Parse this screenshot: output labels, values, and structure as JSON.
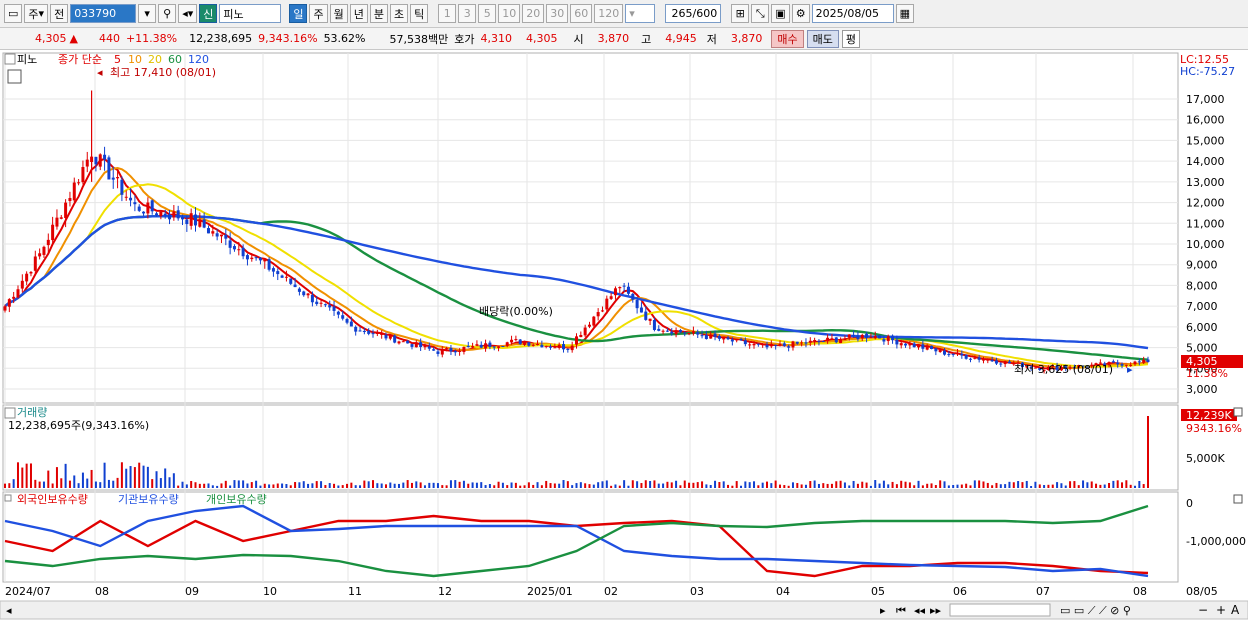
{
  "toolbar": {
    "market_btn": "주",
    "prev_btn": "전",
    "code_value": "033790",
    "badge": "신",
    "name_value": "피노",
    "periods": [
      "일",
      "주",
      "월",
      "년",
      "분",
      "초",
      "틱"
    ],
    "periods_active": "일",
    "intervals": [
      "1",
      "3",
      "5",
      "10",
      "20",
      "30",
      "60",
      "120"
    ],
    "count_value": "265",
    "count_max": "/600",
    "date_value": "2025/08/05"
  },
  "quote": {
    "price": "4,305",
    "arrow": "▲",
    "change": "440",
    "change_pct": "+11.38%",
    "volume": "12,238,695",
    "vol_pct": "9,343.16%",
    "turnover": "53.62%",
    "amount": "57,538백만",
    "hoga_label": "호가",
    "ask": "4,310",
    "bid": "4,305",
    "open_label": "시",
    "open": "3,870",
    "high_label": "고",
    "high": "4,945",
    "low_label": "저",
    "low": "3,870",
    "buy_btn": "매수",
    "sell_btn": "매도",
    "eval_btn": "평"
  },
  "price_panel": {
    "name_tag": "피노",
    "ma_title": "종가 단순",
    "ma_periods": [
      "5",
      "10",
      "20",
      "60",
      "120"
    ],
    "ma_colors": [
      "#e00000",
      "#f09000",
      "#f0e000",
      "#1a9040",
      "#2050e0"
    ],
    "max_note": "최고 17,410 (08/01)",
    "min_note": "최저 3,625 (08/01)",
    "dividend_note": "배당락(0.00%)",
    "lc": "LC:12.55",
    "hc": "HC:-75.27",
    "y_ticks": [
      "17,000",
      "16,000",
      "15,000",
      "14,000",
      "13,000",
      "12,000",
      "11,000",
      "10,000",
      "9,000",
      "8,000",
      "7,000",
      "6,000",
      "5,000",
      "4,000",
      "3,000"
    ],
    "y_values": [
      17000,
      16000,
      15000,
      14000,
      13000,
      12000,
      11000,
      10000,
      9000,
      8000,
      7000,
      6000,
      5000,
      4000,
      3000
    ],
    "last_price_tag": "4,305",
    "last_pct_tag": "11.38%"
  },
  "volume_panel": {
    "title": "거래량",
    "sub": "12,238,695주(9,343.16%)",
    "y_tick": "5,000K",
    "last_tag": "12,239K",
    "last_pct": "9343.16%"
  },
  "holding_panel": {
    "legend": [
      "외국인보유수량",
      "기관보유수량",
      "개인보유수량"
    ],
    "legend_colors": [
      "#e00000",
      "#2050e0",
      "#1a9040"
    ],
    "y_ticks": [
      "0",
      "-1,000,000"
    ]
  },
  "x_axis": {
    "labels": [
      "2024/07",
      "08",
      "09",
      "10",
      "11",
      "12",
      "2025/01",
      "02",
      "03",
      "04",
      "05",
      "06",
      "07",
      "08",
      "08/05"
    ]
  },
  "bottom": {
    "zoom_minus": "−",
    "zoom_plus": "+",
    "auto": "A"
  },
  "chart_data": {
    "type": "candlestick",
    "title": "피노",
    "unit": "KRW",
    "ylim": [
      3000,
      17500
    ],
    "months": [
      "2024/07",
      "08",
      "09",
      "10",
      "11",
      "12",
      "2025/01",
      "02",
      "03",
      "04",
      "05",
      "06",
      "07",
      "08"
    ],
    "close_approx": [
      {
        "date": "2024/07",
        "close": 7000
      },
      {
        "date": "2024/07 mid",
        "close": 9500
      },
      {
        "date": "2024/08/01",
        "close": 14500
      },
      {
        "date": "2024/08 late",
        "close": 11800
      },
      {
        "date": "2024/09",
        "close": 11200
      },
      {
        "date": "2024/10",
        "close": 9000
      },
      {
        "date": "2024/11",
        "close": 6000
      },
      {
        "date": "2024/12",
        "close": 4800
      },
      {
        "date": "2025/01",
        "close": 5300
      },
      {
        "date": "2025/02",
        "close": 5000
      },
      {
        "date": "2025/02 late",
        "close": 8000
      },
      {
        "date": "2025/03",
        "close": 6000
      },
      {
        "date": "2025/04",
        "close": 5000
      },
      {
        "date": "2025/05",
        "close": 5600
      },
      {
        "date": "2025/06",
        "close": 4700
      },
      {
        "date": "2025/07",
        "close": 4000
      },
      {
        "date": "2025/08/05",
        "close": 4305
      }
    ],
    "high": 17410,
    "low": 3625,
    "last": 4305
  }
}
